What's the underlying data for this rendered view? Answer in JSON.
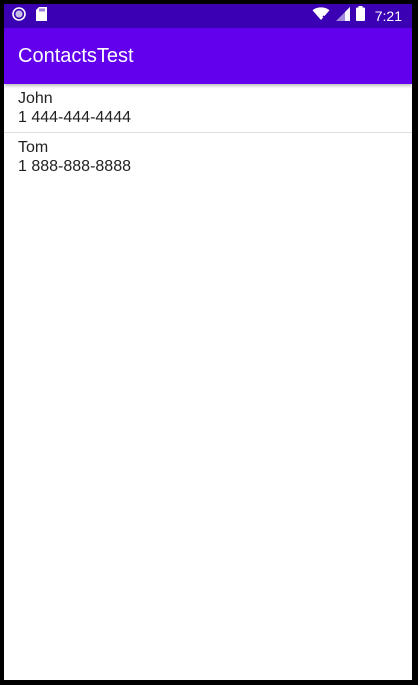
{
  "status_bar": {
    "time": "7:21",
    "icons": {
      "left": [
        "radio-notification-icon",
        "sd-card-icon"
      ],
      "right": [
        "wifi-icon",
        "signal-no-data-icon",
        "battery-icon"
      ]
    },
    "color": "#3b00b4"
  },
  "app_bar": {
    "title": "ContactsTest",
    "color": "#6200ee"
  },
  "contacts": [
    {
      "name": "John",
      "phone": "1 444-444-4444"
    },
    {
      "name": "Tom",
      "phone": "1 888-888-8888"
    }
  ]
}
